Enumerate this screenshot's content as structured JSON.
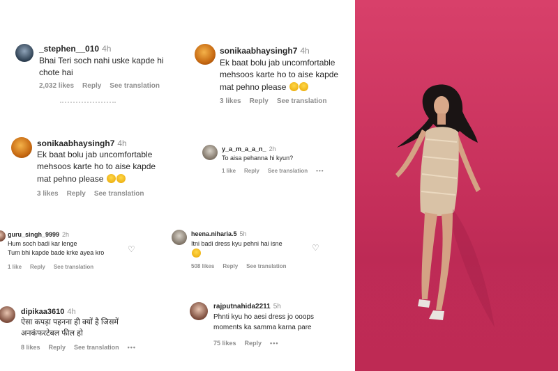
{
  "comments": {
    "c1": {
      "username": "_stephen__010",
      "time": "4h",
      "lines": [
        "Bhai Teri soch nahi uske kapde hi",
        "chote hai"
      ],
      "likes": "2,032 likes",
      "reply": "Reply",
      "see_translation": "See translation"
    },
    "c2": {
      "username": "sonikaabhaysingh7",
      "time": "4h",
      "lines": [
        "Ek baat bolu jab uncomfortable",
        "mehsoos karte ho to aise kapde",
        "mat pehno please"
      ],
      "likes": "3 likes",
      "reply": "Reply",
      "see_translation": "See translation"
    },
    "c3": {
      "username": "sonikaabhaysingh7",
      "time": "4h",
      "lines": [
        "Ek baat bolu jab uncomfortable",
        "mehsoos karte ho to aise kapde",
        "mat pehno please"
      ],
      "likes": "3 likes",
      "reply": "Reply",
      "see_translation": "See translation"
    },
    "c4": {
      "username": "y_a_m_a_a_n_",
      "time": "2h",
      "lines": [
        "To aisa pehanna hi kyun?"
      ],
      "likes": "1 like",
      "reply": "Reply",
      "see_translation": "See translation",
      "more": "•••"
    },
    "c5": {
      "username": "guru_singh_9999",
      "time": "2h",
      "lines": [
        "Hum soch badi kar lenge",
        "Tum bhi kapde bade krke ayea kro"
      ],
      "likes": "1 like",
      "reply": "Reply",
      "see_translation": "See translation"
    },
    "c6": {
      "username": "heena.niharia.5",
      "time": "5h",
      "lines": [
        "Itni badi dress kyu pehni hai isne"
      ],
      "likes": "508 likes",
      "reply": "Reply",
      "see_translation": "See translation"
    },
    "c7": {
      "username": "dipikaa3610",
      "time": "4h",
      "lines": [
        "ऐसा कपड़ा पहनना ही क्यों है जिसमें",
        "अनकंफरटेबल फील हो"
      ],
      "likes": "8 likes",
      "reply": "Reply",
      "see_translation": "See translation",
      "more": "•••"
    },
    "c8": {
      "username": "rajputnahida2211",
      "time": "5h",
      "lines": [
        "Phnti kyu ho aesi dress jo ooops",
        "moments ka samma karna pare"
      ],
      "likes": "75 likes",
      "reply": "Reply",
      "more": "•••"
    }
  },
  "icons": {
    "like": "heart-outline-icon",
    "more": "more-dots-icon",
    "reaction": "crying-emoji-icon"
  },
  "colors": {
    "photo_background": "#c9325d",
    "muted_text": "#8e8e8e"
  }
}
